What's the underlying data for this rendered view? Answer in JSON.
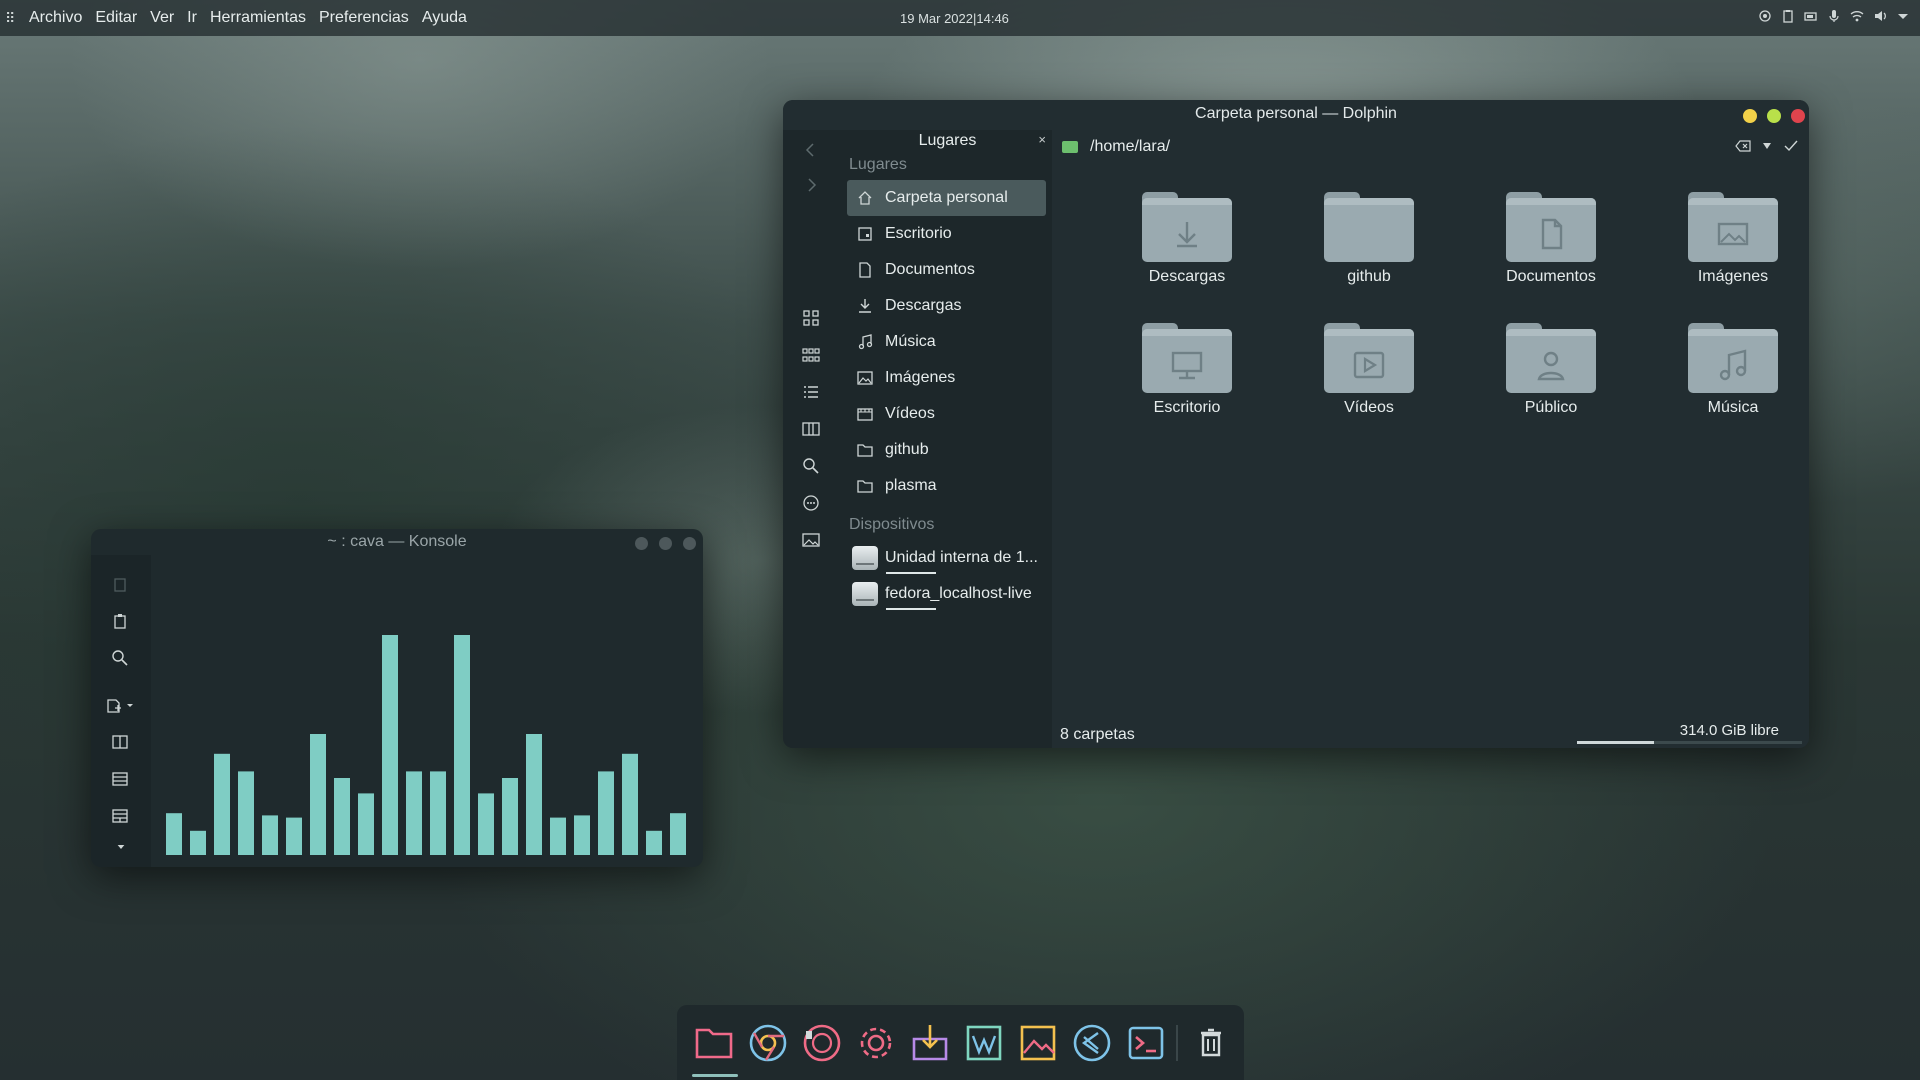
{
  "topbar": {
    "menu": [
      "Archivo",
      "Editar",
      "Ver",
      "Ir",
      "Herramientas",
      "Preferencias",
      "Ayuda"
    ],
    "clock": "19 Mar 2022|14:46",
    "tray_icons": [
      "record-icon",
      "clipboard-icon",
      "battery-icon",
      "microphone-icon",
      "wifi-icon",
      "volume-icon",
      "chevron-down-icon"
    ]
  },
  "dolphin": {
    "title": "Carpeta personal — Dolphin",
    "panel_title": "Lugares",
    "places_section": "Lugares",
    "places": [
      {
        "label": "Carpeta personal",
        "icon": "home-icon"
      },
      {
        "label": "Escritorio",
        "icon": "desktop-icon"
      },
      {
        "label": "Documentos",
        "icon": "document-icon"
      },
      {
        "label": "Descargas",
        "icon": "download-icon"
      },
      {
        "label": "Música",
        "icon": "music-icon"
      },
      {
        "label": "Imágenes",
        "icon": "image-icon"
      },
      {
        "label": "Vídeos",
        "icon": "video-icon"
      },
      {
        "label": "github",
        "icon": "folder-icon"
      },
      {
        "label": "plasma",
        "icon": "folder-icon"
      }
    ],
    "devices_section": "Dispositivos",
    "devices": [
      {
        "label": "Unidad interna de 1..."
      },
      {
        "label": "fedora_localhost-live"
      }
    ],
    "path": "/home/lara/",
    "folders": [
      {
        "name": "Descargas",
        "symbol": "download"
      },
      {
        "name": "github",
        "symbol": "none"
      },
      {
        "name": "Documentos",
        "symbol": "document"
      },
      {
        "name": "Imágenes",
        "symbol": "image"
      },
      {
        "name": "Escritorio",
        "symbol": "desktop"
      },
      {
        "name": "Vídeos",
        "symbol": "video"
      },
      {
        "name": "Público",
        "symbol": "user"
      },
      {
        "name": "Música",
        "symbol": "music"
      }
    ],
    "status_count": "8 carpetas",
    "free_space": "314.0 GiB libre",
    "disk_used_fraction": 0.34
  },
  "konsole": {
    "title": "~ : cava — Konsole",
    "cava_levels": [
      0.19,
      0.11,
      0.46,
      0.38,
      0.18,
      0.17,
      0.55,
      0.35,
      0.28,
      1.0,
      0.38,
      0.38,
      1.0,
      0.28,
      0.35,
      0.55,
      0.17,
      0.18,
      0.38,
      0.46,
      0.11,
      0.19
    ]
  },
  "dock": {
    "apps": [
      "files-icon",
      "chrome-icon",
      "audio-player-icon",
      "settings-icon",
      "software-center-icon",
      "text-editor-icon",
      "image-viewer-icon",
      "vscode-icon",
      "terminal-icon",
      "trash-icon"
    ]
  },
  "colors": {
    "accent": "#7fcdc4",
    "close": "#e0444d",
    "minimize": "#f2d149",
    "maximize": "#b9e04a"
  }
}
